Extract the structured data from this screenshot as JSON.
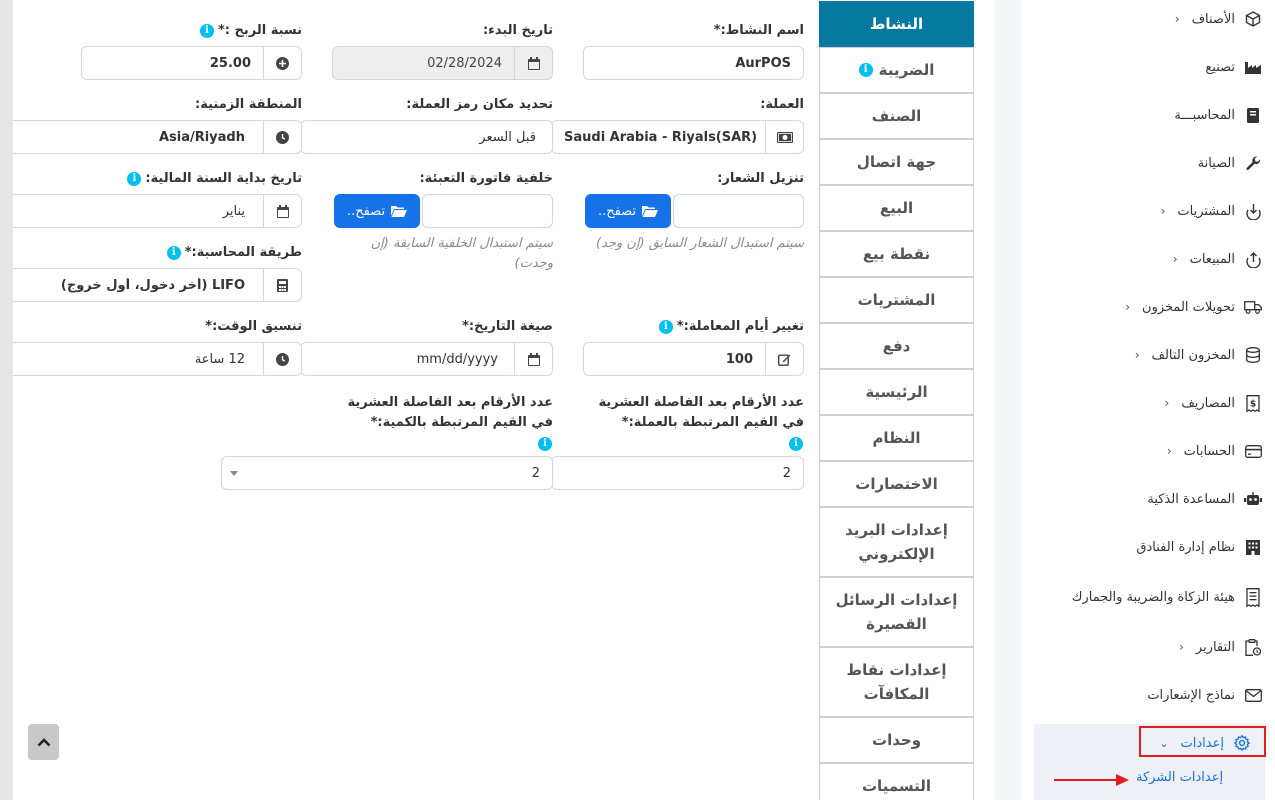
{
  "tabs": [
    {
      "label": "النشاط",
      "active": true
    },
    {
      "label": "الضريبة",
      "info": true
    },
    {
      "label": "الصنف"
    },
    {
      "label": "جهة اتصال"
    },
    {
      "label": "البيع"
    },
    {
      "label": "نقطة بيع"
    },
    {
      "label": "المشتريات"
    },
    {
      "label": "دفع"
    },
    {
      "label": "الرئيسية"
    },
    {
      "label": "النظام"
    },
    {
      "label": "الاختصارات"
    },
    {
      "label": "إعدادات البريد الإلكتروني"
    },
    {
      "label": "إعدادات الرسائل القصيرة"
    },
    {
      "label": "إعدادات نقاط المكافآت"
    },
    {
      "label": "وحدات"
    },
    {
      "label": "التسميات"
    }
  ],
  "form": {
    "business_name": {
      "label": "اسم النشاط:*",
      "value": "AurPOS"
    },
    "start_date": {
      "label": "تاريخ البدء:",
      "value": "02/28/2024"
    },
    "profit_percent": {
      "label": "نسبة الربح :*",
      "value": "25.00"
    },
    "currency": {
      "label": "العملة:",
      "value": "Saudi Arabia - Riyals(SAR)"
    },
    "currency_symbol_placement": {
      "label": "تحديد مكان رمز العملة:",
      "value": "قبل السعر"
    },
    "timezone": {
      "label": "المنطقة الزمنية:",
      "value": "Asia/Riyadh"
    },
    "logo": {
      "label": "تنزيل الشعار:",
      "button": "تصفح..",
      "help": "سيتم استبدال الشعار السابق (إن وجد)"
    },
    "invoice_bg": {
      "label": "خلفية فاتورة التعبئة:",
      "button": "تصفح..",
      "help": "سيتم استبدال الخلفية السابقة (إن وجدت)"
    },
    "fy_start": {
      "label": "تاريخ بداية السنة المالية:",
      "value": "يناير"
    },
    "accounting_method": {
      "label": "طريقة المحاسبة:*",
      "value": "LIFO (أخر دخول، أول خروج)"
    },
    "transaction_edit_days": {
      "label": "تغيير أيام المعاملة:*",
      "value": "100"
    },
    "date_format": {
      "label": "صيغة التاريخ:*",
      "value": "mm/dd/yyyy"
    },
    "time_format": {
      "label": "تنسيق الوقت:*",
      "value": "12 ساعة"
    },
    "currency_precision": {
      "label": "عدد الأرقام بعد الفاصلة العشرية في القيم المرتبطة بالعملة:*",
      "value": "2"
    },
    "quantity_precision": {
      "label": "عدد الأرقام بعد الفاصلة العشرية في القيم المرتبطة بالكمية:*",
      "value": "2"
    }
  },
  "sidebar": {
    "items": [
      {
        "label": "الأصناف",
        "icon": "cube-icon",
        "chevron": true
      },
      {
        "label": "تصنيع",
        "icon": "factory-icon",
        "chevron": false
      },
      {
        "label": "المحاسبـــة",
        "icon": "book-icon",
        "chevron": false
      },
      {
        "label": "الصيانة",
        "icon": "wrench-icon",
        "chevron": false
      },
      {
        "label": "المشتريات",
        "icon": "download-circle-icon",
        "chevron": true
      },
      {
        "label": "المبيعات",
        "icon": "upload-circle-icon",
        "chevron": true
      },
      {
        "label": "تحويلات المخزون",
        "icon": "truck-icon",
        "chevron": true
      },
      {
        "label": "المخزون التالف",
        "icon": "database-icon",
        "chevron": true
      },
      {
        "label": "المصاريف",
        "icon": "receipt-dollar-icon",
        "chevron": true
      },
      {
        "label": "الحسابات",
        "icon": "credit-card-icon",
        "chevron": true
      },
      {
        "label": "المساعدة الذكية",
        "icon": "robot-icon",
        "chevron": false
      },
      {
        "label": "نظام إدارة الفنادق",
        "icon": "building-icon",
        "chevron": false
      },
      {
        "label": "هيئة الزكاة والضريبة والجمارك",
        "icon": "receipt-icon",
        "chevron": false
      },
      {
        "label": "التقارير",
        "icon": "clipboard-clock-icon",
        "chevron": true
      },
      {
        "label": "نماذج الإشعارات",
        "icon": "envelope-icon",
        "chevron": false
      },
      {
        "label": "إعدادات",
        "icon": "gear-icon",
        "chevron": true
      }
    ],
    "sub_item": "إعدادات الشركة"
  },
  "colors": {
    "active_tab": "#0679a3",
    "primary": "#1572e8",
    "info": "#00c0ef",
    "highlight": "#e11d1d"
  }
}
